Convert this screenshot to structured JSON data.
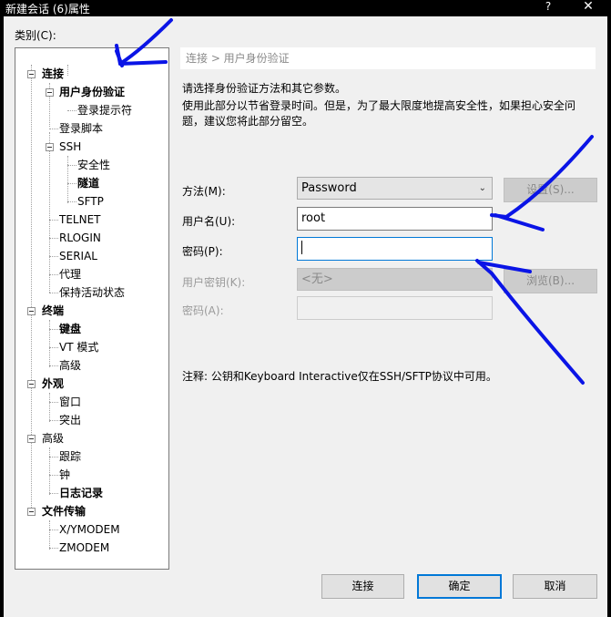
{
  "window": {
    "title": "新建会话 (6)属性",
    "help_glyph": "?",
    "close_glyph": "✕"
  },
  "category_label": "类别(C):",
  "tree": {
    "connection": "连接",
    "auth": "用户身份验证",
    "login_prompts": "登录提示符",
    "login_scripts": "登录脚本",
    "ssh": "SSH",
    "security": "安全性",
    "tunneling": "隧道",
    "sftp": "SFTP",
    "telnet": "TELNET",
    "rlogin": "RLOGIN",
    "serial": "SERIAL",
    "proxy": "代理",
    "keepalive": "保持活动状态",
    "terminal": "终端",
    "keyboard": "键盘",
    "vt_mode": "VT 模式",
    "term_advanced": "高级",
    "appearance": "外观",
    "window": "窗口",
    "highlight": "突出",
    "advanced": "高级",
    "trace": "跟踪",
    "bell": "钟",
    "logging": "日志记录",
    "file_transfer": "文件传输",
    "xymodem": "X/YMODEM",
    "zmodem": "ZMODEM"
  },
  "breadcrumb": "连接 > 用户身份验证",
  "intro": "请选择身份验证方法和其它参数。",
  "note": "使用此部分以节省登录时间。但是，为了最大限度地提高安全性，如果担心安全问题，建议您将此部分留空。",
  "form": {
    "method_label": "方法(M):",
    "method_value": "Password",
    "settings_button": "设置(S)...",
    "username_label": "用户名(U):",
    "username_value": "root",
    "password_label": "密码(P):",
    "password_value": "",
    "userkey_label": "用户密钥(K):",
    "userkey_value": "<无>",
    "browse_button": "浏览(B)...",
    "passphrase_label": "密码(A):",
    "passphrase_value": ""
  },
  "footnote": "注释: 公钥和Keyboard Interactive仅在SSH/SFTP协议中可用。",
  "buttons": {
    "connect": "连接",
    "ok": "确定",
    "cancel": "取消"
  },
  "colors": {
    "annotation": "#0a14e6",
    "focus": "#0078d7"
  }
}
